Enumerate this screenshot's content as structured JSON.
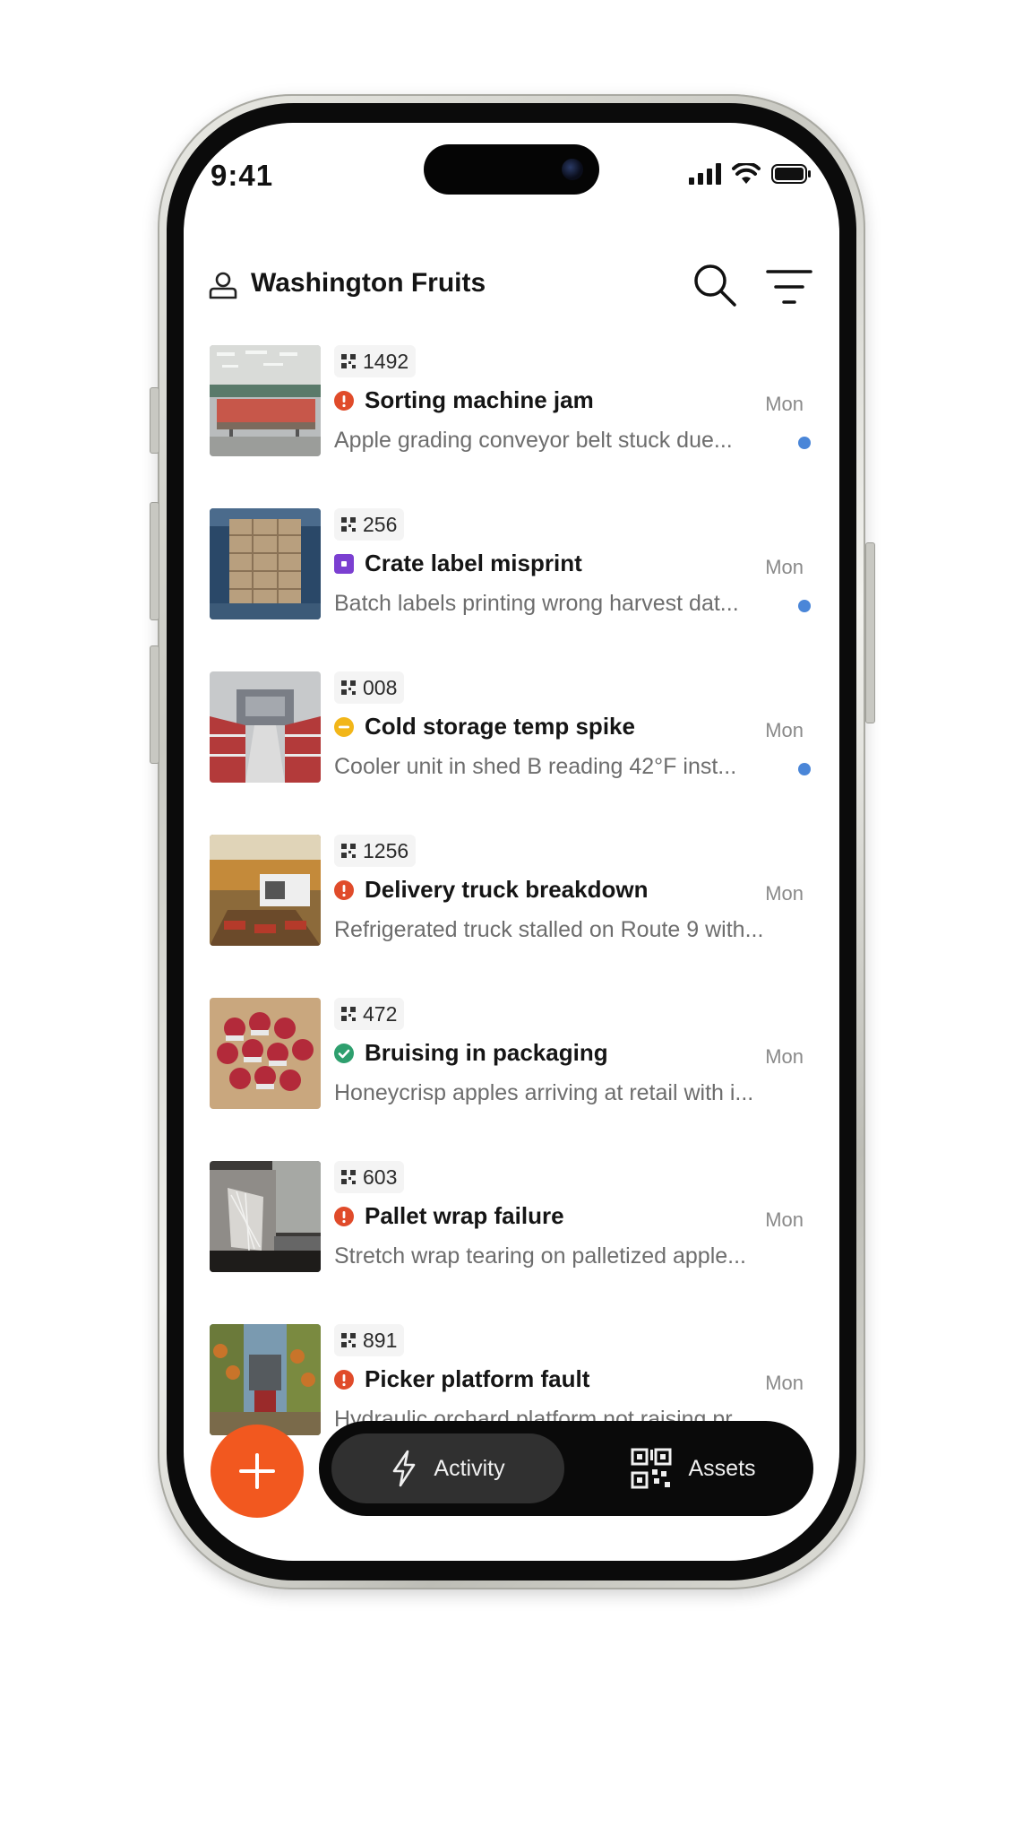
{
  "status_bar": {
    "time": "9:41"
  },
  "header": {
    "title": "Washington Fruits"
  },
  "items": [
    {
      "id": "1492",
      "title": "Sorting machine jam",
      "status": "critical",
      "status_color": "#e04b2a",
      "date": "Mon",
      "preview": "Apple grading conveyor belt stuck due...",
      "unread": true
    },
    {
      "id": "256",
      "title": "Crate label misprint",
      "status": "in-progress",
      "status_color": "#7b3fd1",
      "date": "Mon",
      "preview": "Batch labels printing wrong harvest dat...",
      "unread": true
    },
    {
      "id": "008",
      "title": "Cold storage temp spike",
      "status": "on-hold",
      "status_color": "#f2b619",
      "date": "Mon",
      "preview": "Cooler unit in shed B reading 42°F inst...",
      "unread": true
    },
    {
      "id": "1256",
      "title": "Delivery truck breakdown",
      "status": "critical",
      "status_color": "#e04b2a",
      "date": "Mon",
      "preview": "Refrigerated truck stalled on Route 9 with...",
      "unread": false
    },
    {
      "id": "472",
      "title": "Bruising in packaging",
      "status": "resolved",
      "status_color": "#2e9f6e",
      "date": "Mon",
      "preview": "Honeycrisp apples arriving at retail with i...",
      "unread": false
    },
    {
      "id": "603",
      "title": "Pallet wrap failure",
      "status": "critical",
      "status_color": "#e04b2a",
      "date": "Mon",
      "preview": "Stretch wrap tearing on palletized apple...",
      "unread": false
    },
    {
      "id": "891",
      "title": "Picker platform fault",
      "status": "critical",
      "status_color": "#e04b2a",
      "date": "Mon",
      "preview": "Hydraulic orchard platform not raising pr...",
      "unread": false
    }
  ],
  "tabbar": {
    "activity_label": "Activity",
    "assets_label": "Assets"
  },
  "colors": {
    "accent": "#f2581f",
    "unread": "#4a86d8",
    "tabbar_bg": "#0a0a0a"
  }
}
